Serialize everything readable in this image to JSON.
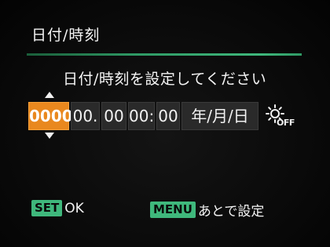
{
  "header": {
    "title": "日付/時刻"
  },
  "prompt": "日付/時刻を設定してください",
  "datetime_fields": [
    {
      "value": "0000.",
      "selected": true
    },
    {
      "value": "00.",
      "selected": false
    },
    {
      "value": "00",
      "selected": false
    },
    {
      "value": "00:",
      "selected": false
    },
    {
      "value": "00",
      "selected": false
    },
    {
      "value": "年/月/日",
      "selected": false
    }
  ],
  "daylight_saving": {
    "icon": "sun-icon",
    "label": "OFF"
  },
  "footer": {
    "set_key": "SET",
    "set_action": "OK",
    "menu_key": "MENU",
    "menu_action": "あとで設定"
  },
  "colors": {
    "accent_orange": "#e9881e",
    "accent_green": "#3fb87c",
    "field_bg": "#2a2a2a"
  }
}
